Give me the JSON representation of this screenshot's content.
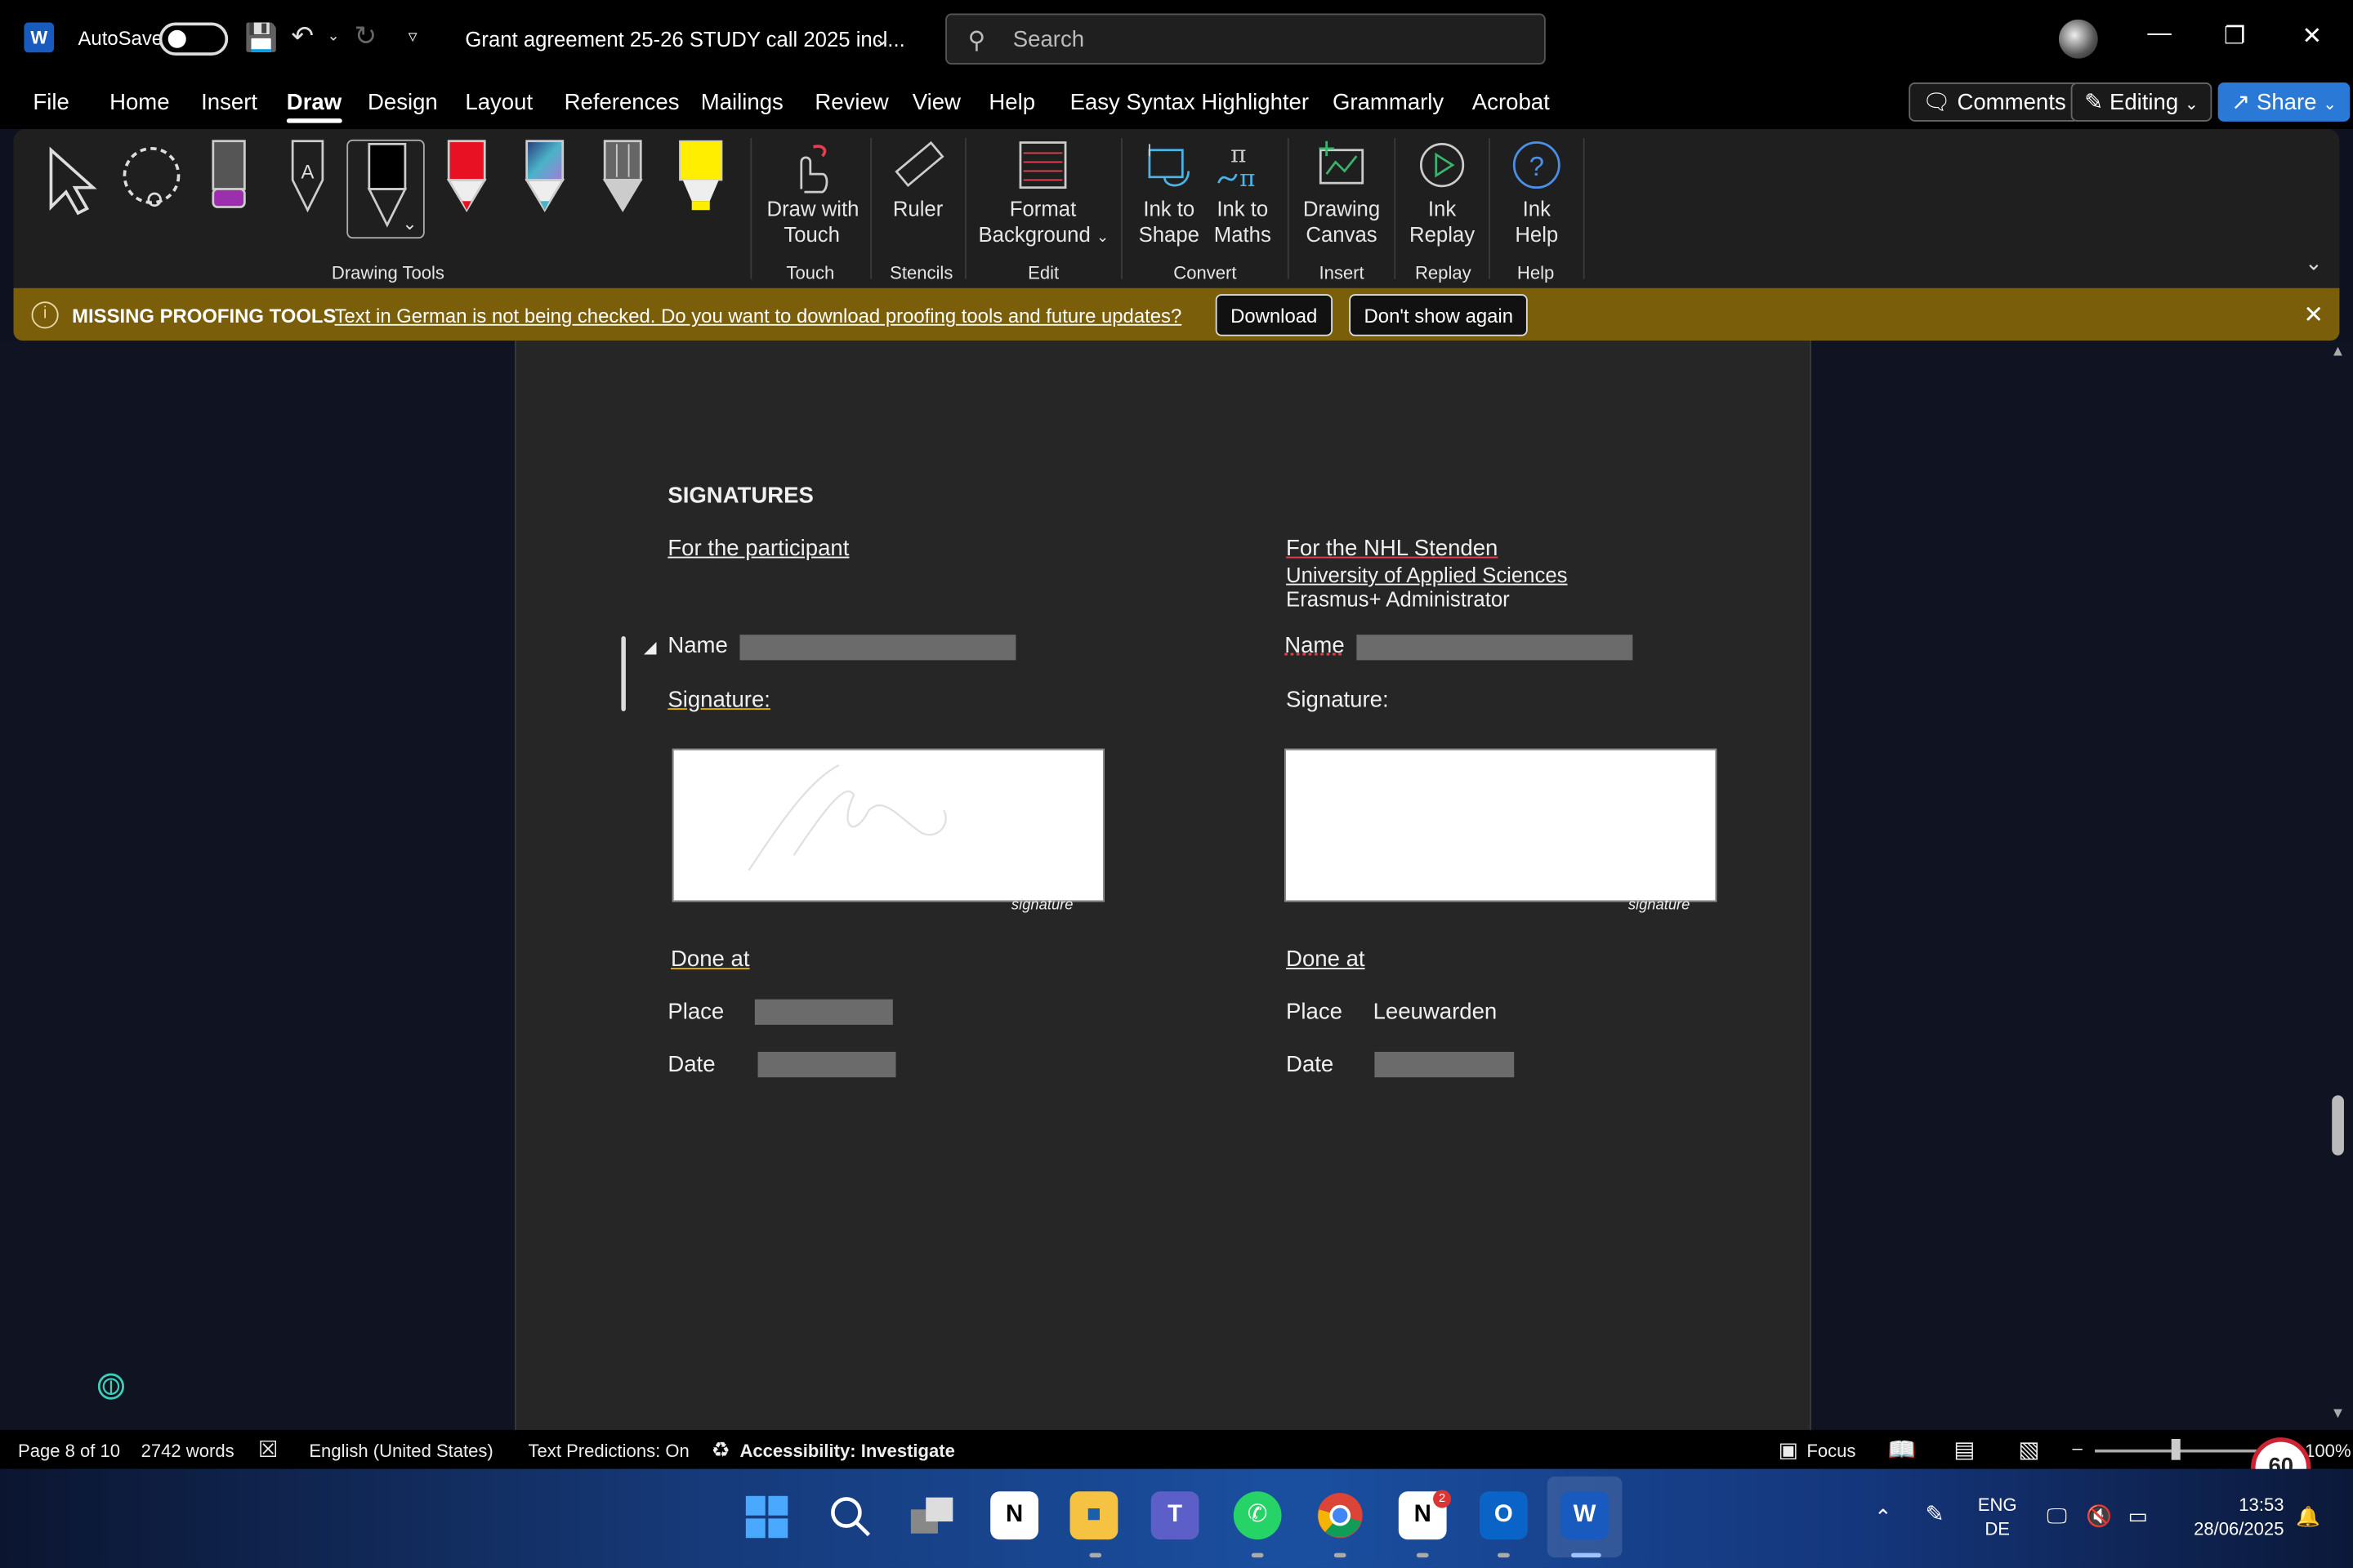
{
  "titlebar": {
    "app_icon": "W",
    "autosave_label": "AutoSave",
    "autosave_state": "off",
    "document_title": "Grant agreement 25-26 STUDY call 2025 incl...",
    "search_placeholder": "Search",
    "icons": [
      "word-logo-icon",
      "save-icon",
      "undo-icon",
      "redo-icon",
      "customize-icon",
      "search-icon",
      "avatar",
      "minimize-icon",
      "restore-icon",
      "close-icon"
    ]
  },
  "menu": {
    "items": [
      "File",
      "Home",
      "Insert",
      "Draw",
      "Design",
      "Layout",
      "References",
      "Mailings",
      "Review",
      "View",
      "Help",
      "Easy Syntax Highlighter",
      "Grammarly",
      "Acrobat"
    ],
    "active": "Draw",
    "comments_label": "Comments",
    "editing_label": "Editing",
    "share_label": "Share"
  },
  "ribbon": {
    "groups": {
      "drawing_tools": "Drawing Tools",
      "touch": "Touch",
      "stencils": "Stencils",
      "edit": "Edit",
      "convert": "Convert",
      "insert": "Insert",
      "replay": "Replay",
      "help": "Help"
    },
    "buttons": {
      "draw_with_touch": [
        "Draw with",
        "Touch"
      ],
      "ruler": "Ruler",
      "format_background": [
        "Format",
        "Background"
      ],
      "ink_to_shape": [
        "Ink to",
        "Shape"
      ],
      "ink_to_maths": [
        "Ink to",
        "Maths"
      ],
      "drawing_canvas": [
        "Drawing",
        "Canvas"
      ],
      "ink_replay": [
        "Ink",
        "Replay"
      ],
      "ink_help": [
        "Ink",
        "Help"
      ]
    },
    "pen_colors": {
      "eraser_accent": "#9b2fae",
      "red_pen": "#e81123",
      "galaxy_pen": "#4ab3c8",
      "highlighter": "#ffee00"
    }
  },
  "notification": {
    "title": "MISSING PROOFING TOOLS",
    "message": "Text in German is not being checked. Do you want to download proofing tools and future updates?",
    "download_label": "Download",
    "dont_show_label": "Don't show again",
    "bg_color": "#7b5e0a"
  },
  "document": {
    "heading": "SIGNATURES",
    "left": {
      "party": "For the participant",
      "name_label": "Name",
      "signature_label": "Signature:",
      "sig_caption": "signature",
      "done_at": "Done at",
      "place_label": "Place",
      "date_label": "Date"
    },
    "right": {
      "party": "For the NHL Stenden",
      "line2": "University of Applied Sciences",
      "line3": "Erasmus+ Administrator",
      "name_label": "Name",
      "signature_label": "Signature:",
      "sig_caption": "signature",
      "done_at": "Done at",
      "place_label": "Place",
      "place_value": "Leeuwarden",
      "date_label": "Date"
    }
  },
  "statusbar": {
    "page": "Page 8 of 10",
    "words": "2742 words",
    "language": "English (United States)",
    "predictions": "Text Predictions: On",
    "accessibility": "Accessibility: Investigate",
    "focus": "Focus",
    "zoom": "100%",
    "badge": "60"
  },
  "taskbar": {
    "apps": [
      "start-icon",
      "search-icon",
      "task-view-icon",
      "notion-icon",
      "file-explorer-icon",
      "teams-icon",
      "whatsapp-icon",
      "chrome-icon",
      "notion-calendar-icon",
      "outlook-icon",
      "word-icon"
    ],
    "notion_badge": "2",
    "lang_line1": "ENG",
    "lang_line2": "DE",
    "time": "13:53",
    "date": "28/06/2025"
  }
}
